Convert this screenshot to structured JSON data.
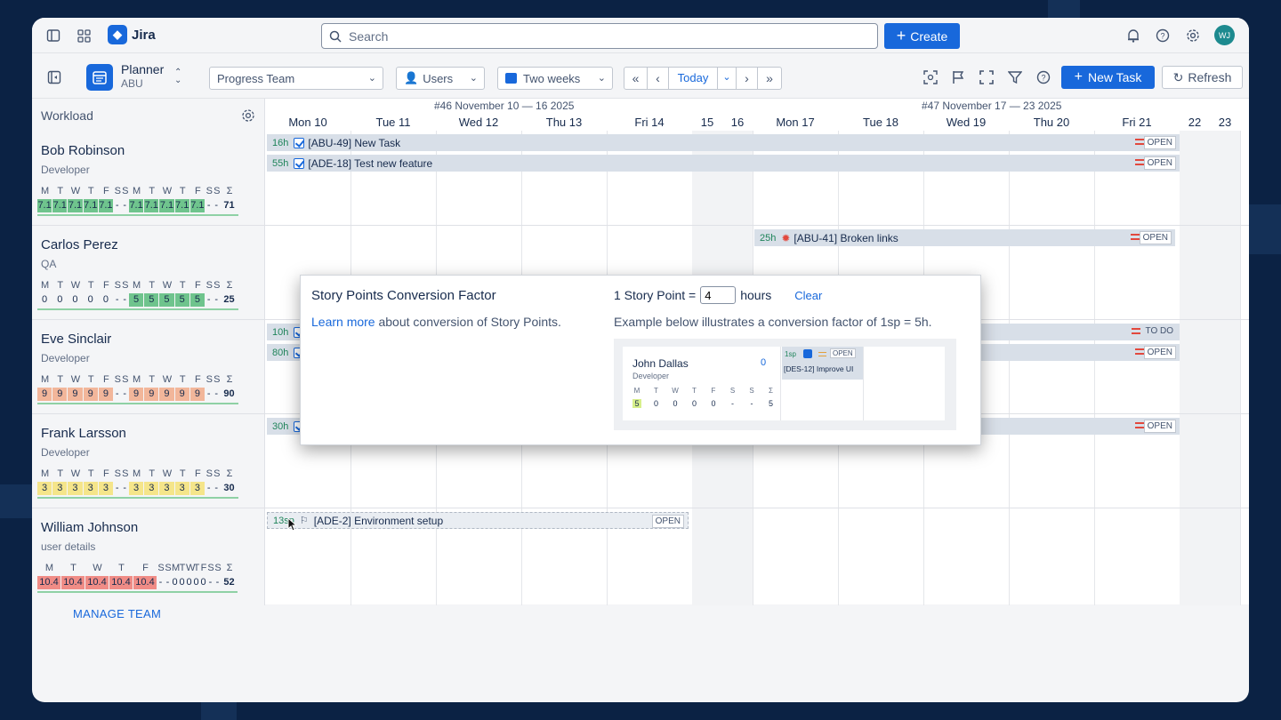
{
  "app": {
    "name": "Jira",
    "search_placeholder": "Search",
    "create_label": "Create",
    "avatar_initials": "WJ"
  },
  "toolbar": {
    "planner_title": "Planner",
    "planner_sub": "ABU",
    "team_select": "Progress Team",
    "users_select": "Users",
    "period_select": "Two weeks",
    "today_label": "Today",
    "new_task_label": "New Task",
    "refresh_label": "Refresh"
  },
  "workload": {
    "title": "Workload",
    "manage_team": "MANAGE TEAM"
  },
  "weeks": [
    {
      "label": "#46 November 10 — 16 2025"
    },
    {
      "label": "#47 November 17 — 23 2025"
    }
  ],
  "days": [
    "Mon 10",
    "Tue 11",
    "Wed 12",
    "Thu 13",
    "Fri 14",
    "15",
    "16",
    "Mon 17",
    "Tue 18",
    "Wed 19",
    "Thu 20",
    "Fri 21",
    "22",
    "23"
  ],
  "people": [
    {
      "name": "Bob Robinson",
      "role": "Developer",
      "letters": [
        "M",
        "T",
        "W",
        "T",
        "F",
        "S",
        "S",
        "M",
        "T",
        "W",
        "T",
        "F",
        "S",
        "S",
        "Σ"
      ],
      "hours": [
        "7.1",
        "7.1",
        "7.1",
        "7.1",
        "7.1",
        "-",
        "-",
        "7.1",
        "7.1",
        "7.1",
        "7.1",
        "7.1",
        "-",
        "-",
        "71"
      ],
      "level": "green"
    },
    {
      "name": "Carlos Perez",
      "role": "QA",
      "letters": [
        "M",
        "T",
        "W",
        "T",
        "F",
        "S",
        "S",
        "M",
        "T",
        "W",
        "T",
        "F",
        "S",
        "S",
        "Σ"
      ],
      "hours": [
        "0",
        "0",
        "0",
        "0",
        "0",
        "-",
        "-",
        "5",
        "5",
        "5",
        "5",
        "5",
        "-",
        "-",
        "25"
      ],
      "level": "green2"
    },
    {
      "name": "Eve Sinclair",
      "role": "Developer",
      "letters": [
        "M",
        "T",
        "W",
        "T",
        "F",
        "S",
        "S",
        "M",
        "T",
        "W",
        "T",
        "F",
        "S",
        "S",
        "Σ"
      ],
      "hours": [
        "9",
        "9",
        "9",
        "9",
        "9",
        "-",
        "-",
        "9",
        "9",
        "9",
        "9",
        "9",
        "-",
        "-",
        "90"
      ],
      "level": "orange"
    },
    {
      "name": "Frank Larsson",
      "role": "Developer",
      "letters": [
        "M",
        "T",
        "W",
        "T",
        "F",
        "S",
        "S",
        "M",
        "T",
        "W",
        "T",
        "F",
        "S",
        "S",
        "Σ"
      ],
      "hours": [
        "3",
        "3",
        "3",
        "3",
        "3",
        "-",
        "-",
        "3",
        "3",
        "3",
        "3",
        "3",
        "-",
        "-",
        "30"
      ],
      "level": "yellow"
    },
    {
      "name": "William Johnson",
      "role": "user details",
      "letters": [
        "M",
        "T",
        "W",
        "T",
        "F",
        "S",
        "S",
        "M",
        "T",
        "W",
        "T",
        "F",
        "S",
        "S",
        "Σ"
      ],
      "hours": [
        "10.4",
        "10.4",
        "10.4",
        "10.4",
        "10.4",
        "-",
        "-",
        "0",
        "0",
        "0",
        "0",
        "0",
        "-",
        "-",
        "52"
      ],
      "level": "red"
    }
  ],
  "tasks": [
    {
      "hrs": "16h",
      "title": "[ABU-49] New Task",
      "status": "OPEN"
    },
    {
      "hrs": "55h",
      "title": "[ADE-18] Test new feature",
      "status": "OPEN"
    },
    {
      "hrs": "25h",
      "title": "[ABU-41] Broken links",
      "status": "OPEN"
    },
    {
      "hrs": "10h",
      "title": "",
      "status": "TO DO"
    },
    {
      "hrs": "80h",
      "title": "",
      "status": "OPEN"
    },
    {
      "hrs": "30h",
      "title": "",
      "status": "OPEN"
    },
    {
      "hrs": "13sp",
      "title": "[ADE-2] Environment setup",
      "status": "OPEN"
    }
  ],
  "modal": {
    "title": "Story Points Conversion Factor",
    "learn_more": "Learn more",
    "learn_rest": " about conversion of Story Points.",
    "sp_prefix": "1 Story Point =",
    "sp_value": "4",
    "sp_suffix": "hours",
    "clear": "Clear",
    "example": "Example below illustrates a conversion factor of 1sp = 5h.",
    "ex_name": "John Dallas",
    "ex_role": "Developer",
    "ex_count": "0",
    "ex_letters": [
      "M",
      "T",
      "W",
      "T",
      "F",
      "S",
      "S",
      "Σ"
    ],
    "ex_values": [
      "5",
      "0",
      "0",
      "0",
      "0",
      "-",
      "-",
      "5"
    ],
    "ex_sp": "1sp",
    "ex_status": "OPEN",
    "ex_task": "[DES-12] Improve UI"
  },
  "colors": {
    "accent": "#1868db",
    "green": "#6fc48d",
    "orange": "#f2b69a",
    "yellow": "#f5e58a",
    "red": "#f08c86"
  }
}
